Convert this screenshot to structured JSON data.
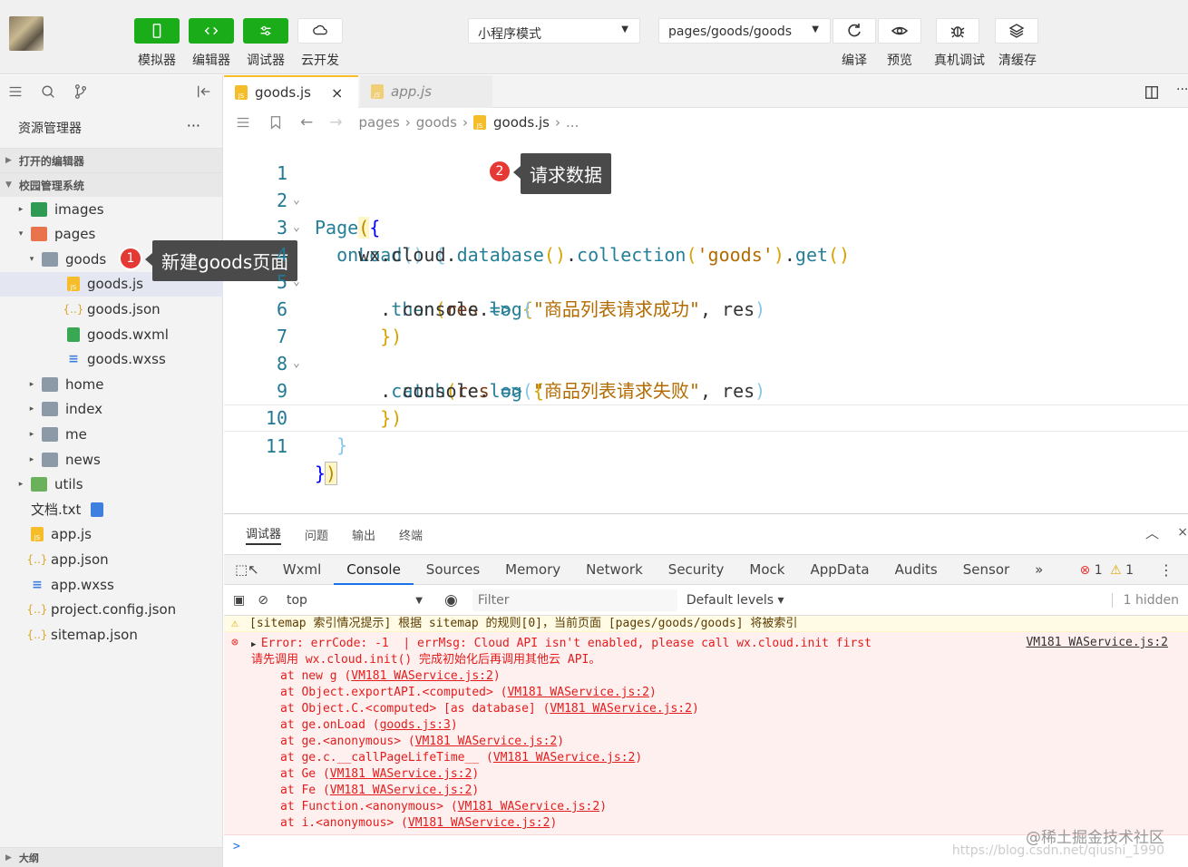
{
  "toolbar": {
    "buttons": [
      {
        "label": "模拟器",
        "icon": "phone-icon"
      },
      {
        "label": "编辑器",
        "icon": "code-icon"
      },
      {
        "label": "调试器",
        "icon": "debug-icon"
      },
      {
        "label": "云开发",
        "icon": "cloud-icon"
      }
    ],
    "mode_select": "小程序模式",
    "page_select": "pages/goods/goods",
    "right_buttons": [
      {
        "label": "编译",
        "icon": "refresh-icon"
      },
      {
        "label": "预览",
        "icon": "eye-icon"
      },
      {
        "label": "真机调试",
        "icon": "bug-icon"
      },
      {
        "label": "清缓存",
        "icon": "layers-icon"
      }
    ]
  },
  "sidebar": {
    "title": "资源管理器",
    "more": "···",
    "open_editors": "打开的编辑器",
    "project": "校园管理系统",
    "tree": [
      {
        "label": "images",
        "kind": "folder-img",
        "twisty": "▸",
        "depth": 1
      },
      {
        "label": "pages",
        "kind": "folder-pages",
        "twisty": "▾",
        "depth": 1
      },
      {
        "label": "goods",
        "kind": "folder",
        "twisty": "▾",
        "depth": 2
      },
      {
        "label": "goods.js",
        "kind": "js",
        "twisty": "",
        "depth": 3,
        "selected": true
      },
      {
        "label": "goods.json",
        "kind": "json",
        "twisty": "",
        "depth": 3
      },
      {
        "label": "goods.wxml",
        "kind": "wxml",
        "twisty": "",
        "depth": 3
      },
      {
        "label": "goods.wxss",
        "kind": "wxss",
        "twisty": "",
        "depth": 3
      },
      {
        "label": "home",
        "kind": "folder",
        "twisty": "▸",
        "depth": 2
      },
      {
        "label": "index",
        "kind": "folder",
        "twisty": "▸",
        "depth": 2
      },
      {
        "label": "me",
        "kind": "folder",
        "twisty": "▸",
        "depth": 2
      },
      {
        "label": "news",
        "kind": "folder",
        "twisty": "▸",
        "depth": 2
      },
      {
        "label": "utils",
        "kind": "folder-utils",
        "twisty": "▸",
        "depth": 1
      },
      {
        "label": "文档.txt",
        "kind": "txt",
        "twisty": "",
        "depth": 1
      },
      {
        "label": "app.js",
        "kind": "js",
        "twisty": "",
        "depth": 1
      },
      {
        "label": "app.json",
        "kind": "json",
        "twisty": "",
        "depth": 1
      },
      {
        "label": "app.wxss",
        "kind": "wxss",
        "twisty": "",
        "depth": 1
      },
      {
        "label": "project.config.json",
        "kind": "json",
        "twisty": "",
        "depth": 1
      },
      {
        "label": "sitemap.json",
        "kind": "json",
        "twisty": "",
        "depth": 1
      }
    ],
    "outline": "大纲"
  },
  "annotations": {
    "badge1": "1",
    "callout1": "新建goods页面",
    "badge2": "2",
    "callout2": "请求数据"
  },
  "editor": {
    "tabs": [
      {
        "label": "goods.js",
        "close": "×"
      },
      {
        "label": "app.js"
      }
    ],
    "breadcrumb": [
      "pages",
      "goods",
      "goods.js",
      "..."
    ],
    "code_lines": [
      {
        "n": "1"
      },
      {
        "n": "2"
      },
      {
        "n": "3"
      },
      {
        "n": "4"
      },
      {
        "n": "5"
      },
      {
        "n": "6"
      },
      {
        "n": "7"
      },
      {
        "n": "8"
      },
      {
        "n": "9"
      },
      {
        "n": "10"
      },
      {
        "n": "11"
      }
    ],
    "code": {
      "l1_page": "Page",
      "l2_onload": "onLoad",
      "l3_wx": "wx",
      "l3_cloud": "cloud",
      "l3_database": "database",
      "l3_collection": "collection",
      "l3_goods": "'goods'",
      "l3_get": "get",
      "l4_then": "then",
      "l4_res": "res",
      "l5_console": "console",
      "l5_log": "log",
      "l5_str": "\"商品列表请求成功\"",
      "l5_res": "res",
      "l7_catch": "catch",
      "l7_res": "res",
      "l8_console": "console",
      "l8_log": "log",
      "l8_str": "\"商品列表请求失败\"",
      "l8_res": "res"
    }
  },
  "debugger": {
    "top_tabs": [
      "调试器",
      "问题",
      "输出",
      "终端"
    ],
    "panel_tabs": [
      "Wxml",
      "Console",
      "Sources",
      "Memory",
      "Network",
      "Security",
      "Mock",
      "AppData",
      "Audits",
      "Sensor"
    ],
    "more_tabs": "»",
    "error_count": "1",
    "warn_count": "1",
    "context": "top",
    "filter_placeholder": "Filter",
    "levels": "Default levels ▾",
    "hidden": "1 hidden",
    "warning": "[sitemap 索引情况提示] 根据 sitemap 的规则[0]，当前页面 [pages/goods/goods] 将被索引",
    "error_head": "Error: errCode: -1  | errMsg: Cloud API isn't enabled, please call wx.cloud.init first",
    "error_src": "VM181 WAService.js:2",
    "error_line2": "请先调用 wx.cloud.init() 完成初始化后再调用其他云 API。",
    "stack": [
      {
        "text": "at new g (",
        "link": "VM181 WAService.js:2"
      },
      {
        "text": "at Object.exportAPI.<computed> (",
        "link": "VM181 WAService.js:2"
      },
      {
        "text": "at Object.C.<computed> [as database] (",
        "link": "VM181 WAService.js:2"
      },
      {
        "text": "at ge.onLoad (",
        "link": "goods.js:3"
      },
      {
        "text": "at ge.<anonymous> (",
        "link": "VM181 WAService.js:2"
      },
      {
        "text": "at ge.c.__callPageLifeTime__ (",
        "link": "VM181 WAService.js:2"
      },
      {
        "text": "at Ge (",
        "link": "VM181 WAService.js:2"
      },
      {
        "text": "at Fe (",
        "link": "VM181 WAService.js:2"
      },
      {
        "text": "at Function.<anonymous> (",
        "link": "VM181 WAService.js:2"
      },
      {
        "text": "at i.<anonymous> (",
        "link": "VM181 WAService.js:2"
      }
    ],
    "prompt": ">",
    "watermark1": "@稀土掘金技术社区",
    "watermark2": "https://blog.csdn.net/qiushi_1990"
  }
}
